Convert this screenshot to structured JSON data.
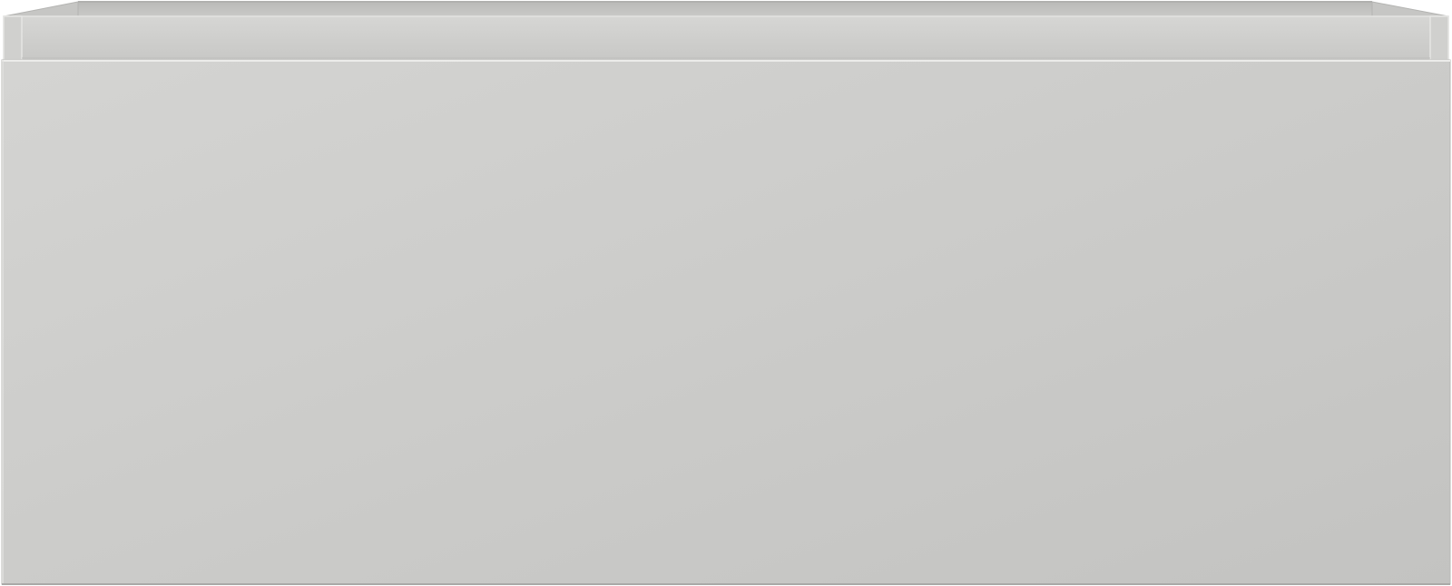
{
  "subject": {
    "kind": "drawer-unit-front-elevation",
    "material_color": "#cfcfcd",
    "edge_color": "#e6e6e4",
    "shadow_color": "#a9a9a7"
  }
}
